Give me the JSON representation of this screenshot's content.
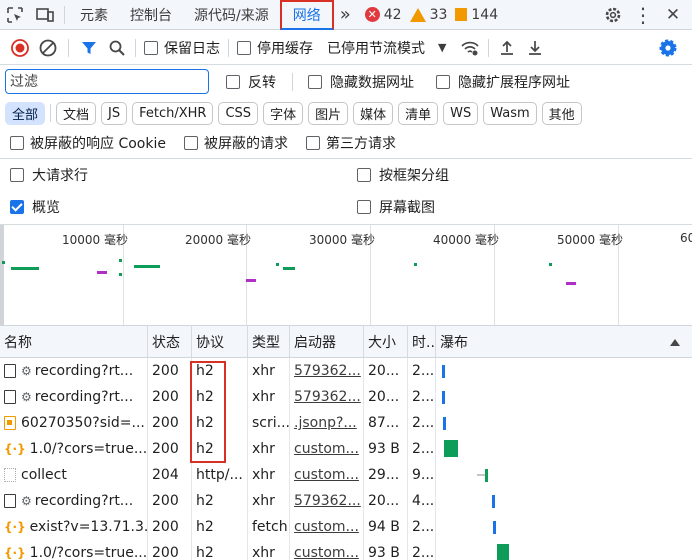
{
  "tabs": {
    "elements": "元素",
    "console": "控制台",
    "sources": "源代码/来源",
    "network": "网络",
    "more": "»",
    "errors": "42",
    "warnings": "33",
    "issues": "144"
  },
  "toolbar": {
    "preserve_log": "保留日志",
    "disable_cache": "停用缓存",
    "throttling": "已停用节流模式"
  },
  "filter": {
    "placeholder": "过滤",
    "invert": "反转",
    "hide_data_urls": "隐藏数据网址",
    "hide_extension_urls": "隐藏扩展程序网址"
  },
  "types": [
    "全部",
    "文档",
    "JS",
    "Fetch/XHR",
    "CSS",
    "字体",
    "图片",
    "媒体",
    "清单",
    "WS",
    "Wasm",
    "其他"
  ],
  "options": {
    "blocked_cookies": "被屏蔽的响应 Cookie",
    "blocked_requests": "被屏蔽的请求",
    "third_party": "第三方请求",
    "big_rows": "大请求行",
    "group_by_frame": "按框架分组",
    "overview": "概览",
    "screenshots": "屏幕截图"
  },
  "overview_labels": [
    "10000 毫秒",
    "20000 毫秒",
    "30000 毫秒",
    "40000 毫秒",
    "50000 毫秒",
    "60"
  ],
  "columns": {
    "name": "名称",
    "status": "状态",
    "protocol": "协议",
    "type": "类型",
    "initiator": "启动器",
    "size": "大小",
    "time": "时...",
    "waterfall": "瀑布"
  },
  "rows": [
    {
      "name": "recording?rt...",
      "status": "200",
      "protocol": "h2",
      "type": "xhr",
      "initiator": "579362...",
      "size": "20...",
      "time": "2..."
    },
    {
      "name": "recording?rt...",
      "status": "200",
      "protocol": "h2",
      "type": "xhr",
      "initiator": "579362...",
      "size": "20...",
      "time": "2..."
    },
    {
      "name": "60270350?sid=...",
      "status": "200",
      "protocol": "h2",
      "type": "scri...",
      "initiator": ".jsonp?...",
      "size": "87...",
      "time": "2..."
    },
    {
      "name": "1.0/?cors=true...",
      "status": "200",
      "protocol": "h2",
      "type": "xhr",
      "initiator": "custom...",
      "size": "93 B",
      "time": "2..."
    },
    {
      "name": "collect",
      "status": "204",
      "protocol": "http/...",
      "type": "xhr",
      "initiator": "custom...",
      "size": "29...",
      "time": "9..."
    },
    {
      "name": "recording?rt...",
      "status": "200",
      "protocol": "h2",
      "type": "xhr",
      "initiator": "579362...",
      "size": "20...",
      "time": "4..."
    },
    {
      "name": "exist?v=13.71.3...",
      "status": "200",
      "protocol": "h2",
      "type": "fetch",
      "initiator": "custom...",
      "size": "94 B",
      "time": "2..."
    },
    {
      "name": "1.0/?cors=true...",
      "status": "200",
      "protocol": "h2",
      "type": "xhr",
      "initiator": "custom...",
      "size": "93 B",
      "time": "2..."
    }
  ]
}
